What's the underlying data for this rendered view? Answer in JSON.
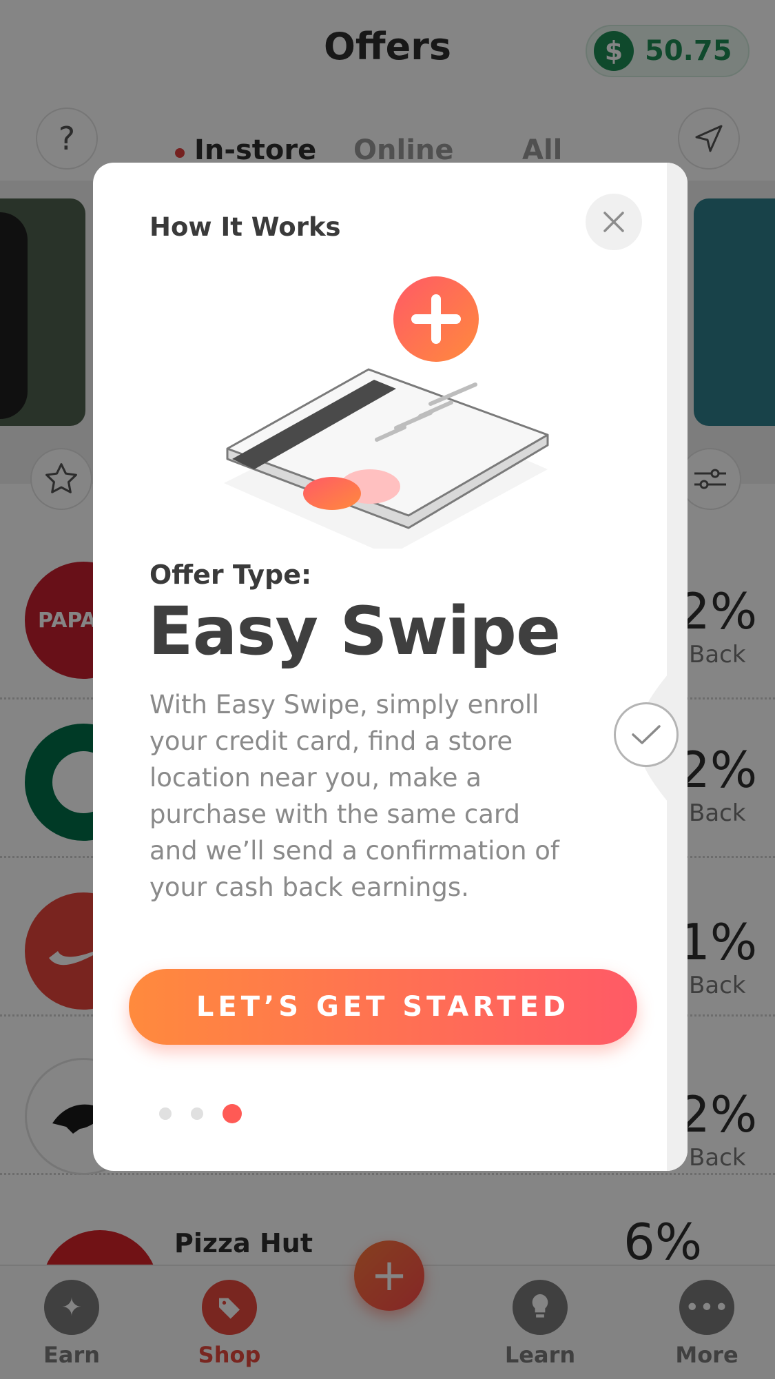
{
  "header": {
    "title": "Offers",
    "balance": "50.75",
    "currency_symbol": "$"
  },
  "tabs": [
    {
      "label": "In-store",
      "active": true
    },
    {
      "label": "Online",
      "active": false
    },
    {
      "label": "All",
      "active": false
    }
  ],
  "help_icon": "?",
  "offers": [
    {
      "brand": "Papa John's",
      "percent": "2%",
      "back": "Back",
      "logo_color": "#c8202f",
      "logo_text": "PAPA JO"
    },
    {
      "brand": "Starbucks",
      "percent": "2%",
      "back": "Back",
      "logo_color": "#00704a"
    },
    {
      "brand": "Nike",
      "percent": "1%",
      "back": "Back",
      "logo_color": "#e8453c"
    },
    {
      "brand": "Puma",
      "percent": "2%",
      "back": "Back",
      "logo_color": "#ffffff"
    }
  ],
  "pizza_hut": {
    "name": "Pizza Hut",
    "percent": "6%"
  },
  "bottom_nav": [
    {
      "label": "Earn",
      "icon": "sparkle-icon"
    },
    {
      "label": "Shop",
      "icon": "tag-icon",
      "active": true
    },
    {
      "label": "Learn",
      "icon": "lightbulb-icon"
    },
    {
      "label": "More",
      "icon": "more-icon"
    }
  ],
  "fab_symbol": "+",
  "modal": {
    "heading": "How It Works",
    "offer_type_label": "Offer Type:",
    "offer_type_name": "Easy Swipe",
    "description": "With Easy Swipe, simply enroll your credit card, find a store location near you, make a purchase with the same card and we’ll send a confirmation of your cash back earnings.",
    "cta_label": "LET’S GET STARTED",
    "pagination": {
      "total": 3,
      "current": 3
    }
  },
  "colors": {
    "accent": "#ff5a55",
    "cta_start": "#ff8a3d",
    "cta_end": "#ff5a66",
    "balance_green": "#1e8c55"
  }
}
